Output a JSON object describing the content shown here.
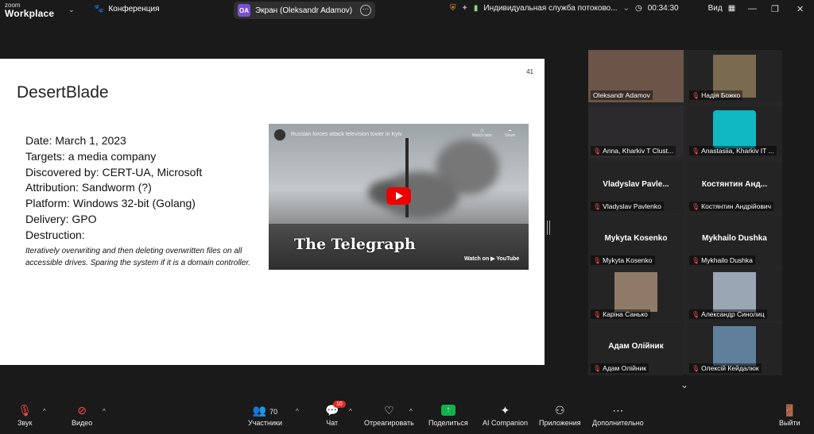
{
  "topbar": {
    "logo_top": "zoom",
    "logo_bottom": "Workplace",
    "conference_label": "Конференция",
    "screen_initials": "OA",
    "screen_label": "Экран (Oleksandr Adamov)",
    "service_label": "Индивидуальная служба потоково...",
    "timer": "00:34:30",
    "view_label": "Вид"
  },
  "slide": {
    "page_number": "41",
    "title": "DesertBlade",
    "lines": [
      "Date: March 1, 2023",
      "Targets: a media company",
      "Discovered by: CERT-UA, Microsoft",
      "Attribution: Sandworm (?)",
      "Platform: Windows 32-bit (Golang)",
      "Delivery: GPO",
      "Destruction:"
    ],
    "description": "Iteratively overwriting and then deleting overwritten files on all accessible drives. Sparing the system if it is a domain controller.",
    "video": {
      "title": "Russian forces attack television tower in Kyiv",
      "watch_later": "Watch later",
      "share": "Share",
      "brand": "The Telegraph",
      "watch_on": "Watch on ▶ YouTube"
    }
  },
  "participants": [
    {
      "big": "",
      "label": "Oleksandr Adamov",
      "muted": false,
      "photo": "#6b5448"
    },
    {
      "big": "",
      "label": "Надія Божко",
      "muted": true,
      "photo": "#7a6a50"
    },
    {
      "big": "",
      "label": "Anna, Kharkiv T Clust...",
      "muted": true,
      "photo": "#2c2a2c"
    },
    {
      "big": "",
      "label": "Anastasiia, Kharkiv IT ...",
      "muted": true,
      "photo": "#10b8c4"
    },
    {
      "big": "Vladyslav  Pavle...",
      "label": "Vladyslav Pavlenko",
      "muted": true
    },
    {
      "big": "Костянтин  Анд...",
      "label": "Костянтин Андрійович",
      "muted": true
    },
    {
      "big": "Mykyta Kosenko",
      "label": "Mykyta Kosenko",
      "muted": true
    },
    {
      "big": "Mykhailo Dushka",
      "label": "Mykhailo Dushka",
      "muted": true
    },
    {
      "big": "",
      "label": "Каріна Санько",
      "muted": true,
      "photo": "#8f7a68"
    },
    {
      "big": "",
      "label": "Александр Синолиц",
      "muted": true,
      "photo": "#9aa6b4"
    },
    {
      "big": "Адам Олійник",
      "label": "Адам Олійник",
      "muted": true
    },
    {
      "big": "",
      "label": "Олексій Кейдалюк",
      "muted": true,
      "photo": "#5f7f9a"
    }
  ],
  "toolbar": {
    "audio": "Звук",
    "video": "Видео",
    "participants_count": "70",
    "participants": "Участники",
    "chat": "Чат",
    "chat_badge": "10",
    "react": "Отреагировать",
    "share": "Поделиться",
    "ai": "AI Companion",
    "apps": "Приложения",
    "more": "Дополнительно",
    "leave": "Выйти"
  },
  "colors": {
    "active_speaker": "#3cd17c",
    "muted_mic": "#ff4d4d",
    "share": "#12b34b"
  }
}
